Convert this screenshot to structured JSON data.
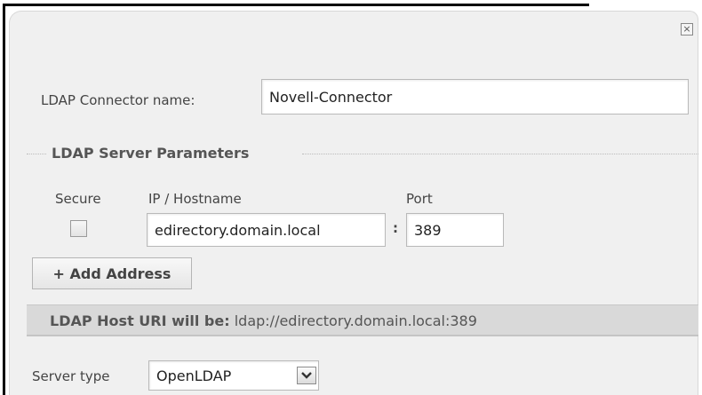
{
  "dialog": {
    "close_glyph": "×"
  },
  "connector": {
    "label": "LDAP Connector name:",
    "value": "Novell-Connector"
  },
  "server_params": {
    "legend": "LDAP Server Parameters",
    "secure_header": "Secure",
    "host_header": "IP / Hostname",
    "port_header": "Port",
    "secure_checked": false,
    "host_value": "edirectory.domain.local",
    "separator": ":",
    "port_value": "389",
    "add_address_label": "+ Add Address",
    "uri_label": "LDAP Host URI will be:",
    "uri_value": "ldap://edirectory.domain.local:389"
  },
  "server_type": {
    "label": "Server type",
    "selected": "OpenLDAP"
  }
}
